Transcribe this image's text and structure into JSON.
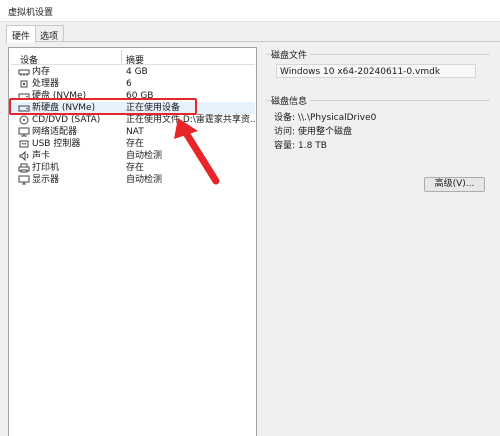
{
  "window": {
    "title": "虚拟机设置"
  },
  "tabs": [
    {
      "label": "硬件",
      "active": true
    },
    {
      "label": "选项",
      "active": false
    }
  ],
  "device_table": {
    "headers": {
      "device": "设备",
      "summary": "摘要"
    },
    "rows": [
      {
        "device": "内存",
        "summary": "4 GB",
        "icon": "memory-icon"
      },
      {
        "device": "处理器",
        "summary": "6",
        "icon": "cpu-icon"
      },
      {
        "device": "硬盘 (NVMe)",
        "summary": "60 GB",
        "icon": "hard-disk-icon"
      },
      {
        "device": "新硬盘 (NVMe)",
        "summary": "正在使用设备",
        "icon": "hard-disk-icon",
        "selected": true
      },
      {
        "device": "CD/DVD (SATA)",
        "summary": "正在使用文件 D:\\雷霆家共享资...",
        "icon": "cd-dvd-icon"
      },
      {
        "device": "网络适配器",
        "summary": "NAT",
        "icon": "network-adapter-icon"
      },
      {
        "device": "USB 控制器",
        "summary": "存在",
        "icon": "usb-icon"
      },
      {
        "device": "声卡",
        "summary": "自动检测",
        "icon": "sound-card-icon"
      },
      {
        "device": "打印机",
        "summary": "存在",
        "icon": "printer-icon"
      },
      {
        "device": "显示器",
        "summary": "自动检测",
        "icon": "display-icon"
      }
    ]
  },
  "disk_file": {
    "title": "磁盘文件",
    "value": "Windows 10 x64-20240611-0.vmdk"
  },
  "disk_info": {
    "title": "磁盘信息",
    "device_label": "设备:",
    "device_value": "\\\\.\\PhysicalDrive0",
    "access_label": "访问:",
    "access_value": "使用整个磁盘",
    "capacity_label": "容量:",
    "capacity_value": "1.8 TB"
  },
  "buttons": {
    "advanced": "高级(V)..."
  },
  "colors": {
    "annotation": "#e8262a",
    "selection": "#e5f1fb"
  }
}
